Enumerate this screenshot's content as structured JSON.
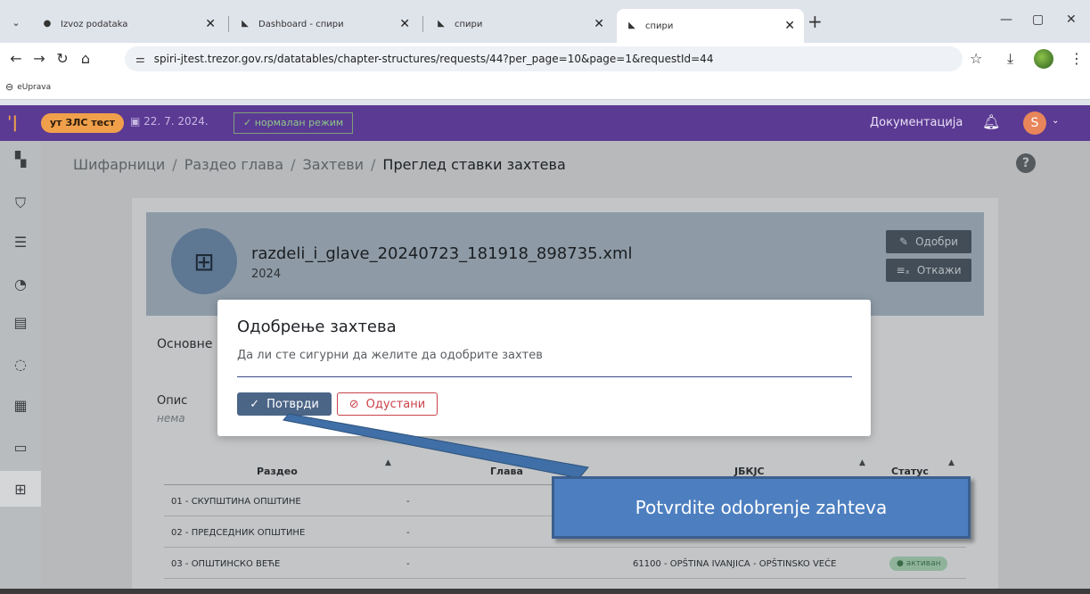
{
  "browser": {
    "tabs": [
      {
        "label": "Izvoz podataka",
        "icon": "globe-icon",
        "active": false
      },
      {
        "label": "Dashboard - спири",
        "icon": "spiri-favicon",
        "active": false
      },
      {
        "label": "спири",
        "icon": "spiri-favicon",
        "active": false
      },
      {
        "label": "спири",
        "icon": "spiri-favicon",
        "active": true
      }
    ],
    "url": "spiri-jtest.trezor.gov.rs/datatables/chapter-structures/requests/44?per_page=10&page=1&requestId=44",
    "bookmarks": [
      {
        "label": "eUprava",
        "icon": "euprava-icon"
      }
    ]
  },
  "app_header": {
    "env_badge": "ут ЗЛС тест",
    "date": "22. 7. 2024.",
    "mode": "нормалан режим",
    "docs_link": "Документација",
    "user_initial": "S"
  },
  "breadcrumb": {
    "items": [
      "Шифарници",
      "Раздео глава",
      "Захтеви"
    ],
    "current": "Преглед ставки захтева"
  },
  "request": {
    "file_name": "razdeli_i_glave_20240723_181918_898735.xml",
    "year": "2024",
    "approve_label": "Одобри",
    "reject_label": "Откажи",
    "basic_section": "Основне",
    "desc_label": "Опис",
    "desc_value": "нема"
  },
  "table": {
    "columns": [
      "Раздео",
      "Глава",
      "ЈБКЈС",
      "Статус"
    ],
    "rows": [
      {
        "razdeo": "01 - СКУПШТИНА ОПШТИНЕ",
        "glava": "-",
        "jbkjs": "",
        "status": ""
      },
      {
        "razdeo": "02 - ПРЕДСЕДНИК ОПШТИНЕ",
        "glava": "-",
        "jbkjs": "",
        "status": ""
      },
      {
        "razdeo": "03 - ОПШТИНСКО ВЕЋЕ",
        "glava": "-",
        "jbkjs": "61100 - OPŠTINA IVANJICA - OPŠTINSKO VEĆE",
        "status": "активан"
      }
    ]
  },
  "modal": {
    "title": "Одобрење захтева",
    "text": "Да ли сте сигурни да желите да одобрите захтев",
    "confirm_label": "Потврди",
    "cancel_label": "Одустани"
  },
  "callout": {
    "text": "Potvrdite odobrenje zahteva"
  },
  "colors": {
    "header_purple": "#5b3a93",
    "env_badge_orange": "#f0a04b",
    "confirm_blue": "#4b6587",
    "cancel_red": "#c9434b",
    "callout_blue": "#4d7fc0"
  }
}
